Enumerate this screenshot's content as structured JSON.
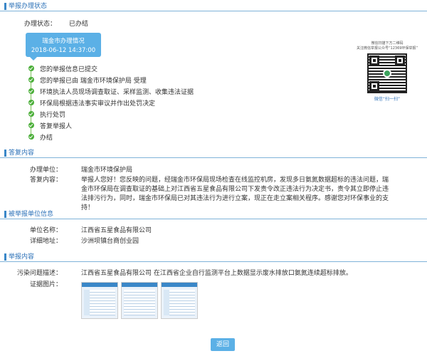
{
  "sections": {
    "process": "举报办理状态",
    "reply": "答复内容",
    "reported_unit": "被举报单位信息",
    "report_content": "举报内容"
  },
  "status": {
    "label": "办理状态：",
    "value": "已办结"
  },
  "stamp": {
    "title": "瑞金市办理情况",
    "datetime": "2018-06-12 14:37:00"
  },
  "timeline": [
    "您的举报信息已提交",
    "您的举报已由 瑞金市环境保护局 受理",
    "环境执法人员现场调查取证、采样监测、收集违法证据",
    "环保局根据违法事实审议并作出处罚决定",
    "执行处罚",
    "答复举报人",
    "办结"
  ],
  "qr": {
    "caption1": "微信扫描下方二维码",
    "caption2": "关注微信举报公众号“12369环保举报”",
    "scan_label": "微信“扫一扫”"
  },
  "reply": {
    "unit_label": "办理单位",
    "unit_value": "瑞金市环境保护局",
    "content_label": "答复内容",
    "content_value": "举报人您好！您反映的问题，经瑞金市环保局现场检查在线监控机房，发现多日氨氮数据超标的违法问题，瑞金市环保局在调查取证的基础上对江西省五星食品有限公司下发责令改正违法行为决定书，责令其立即停止违法排污行为，同时，瑞金市环保局已对其违法行为进行立案，现正在走立案相关程序。感谢您对环保事业的支持！"
  },
  "reported_unit": {
    "name_label": "单位名称",
    "name_value": "江西省五星食品有限公司",
    "address_label": "详细地址",
    "address_value": "沙洲坝镇台商创业园"
  },
  "report_content": {
    "desc_label": "污染问题描述",
    "desc_value": "江西省五星食品有限公司 在江西省企业自行监测平台上数据显示废水排放口氨氮连续超标排放。",
    "images_label": "证据图片"
  },
  "colon": "：",
  "back_button": "返回",
  "colors": {
    "accent": "#5bb0e6",
    "section_title": "#2d72b8",
    "timeline_green": "#4caf3a"
  }
}
